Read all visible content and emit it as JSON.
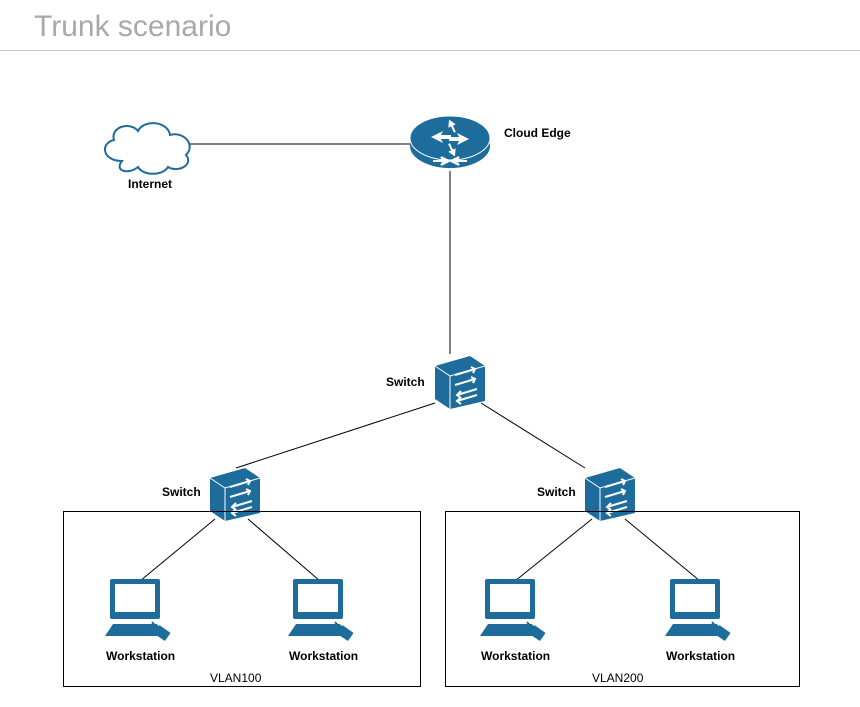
{
  "title": "Trunk scenario",
  "labels": {
    "internet": "Internet",
    "cloud_edge": "Cloud Edge",
    "switch_top": "Switch",
    "switch_left": "Switch",
    "switch_right": "Switch",
    "ws_left_a": "Workstation",
    "ws_left_b": "Workstation",
    "ws_right_a": "Workstation",
    "ws_right_b": "Workstation"
  },
  "groups": {
    "vlan_left": "VLAN100",
    "vlan_right": "VLAN200"
  },
  "colors": {
    "primary": "#1d6c9b",
    "stroke": "#000000",
    "title": "#a9a9a9"
  }
}
